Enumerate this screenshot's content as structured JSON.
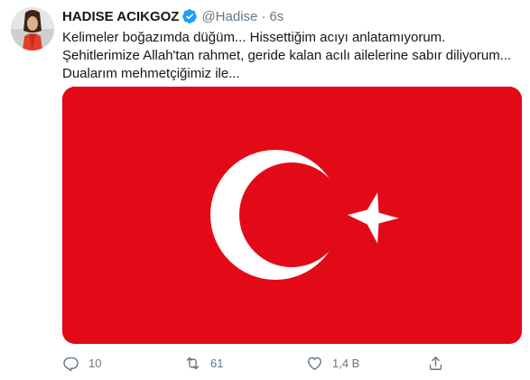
{
  "tweet": {
    "display_name": "HADISE ACIKGOZ",
    "handle": "@Hadise",
    "separator": "·",
    "time": "6s",
    "text": "Kelimeler boğazımda düğüm... Hissettiğim acıyı anlatamıyorum. Şehitlerimize Allah'tan rahmet, geride kalan acılı ailelerine sabır diliyorum... Dualarım mehmetçiğimiz ile...",
    "verified": true
  },
  "media": {
    "type": "flag",
    "icon": "turkish-flag",
    "colors": {
      "background": "#e30a17",
      "symbol": "#ffffff"
    }
  },
  "actions": {
    "reply_count": "10",
    "retweet_count": "61",
    "like_count": "1,4 B"
  },
  "colors": {
    "secondary_text": "#657786",
    "verified_badge": "#1da1f2"
  }
}
